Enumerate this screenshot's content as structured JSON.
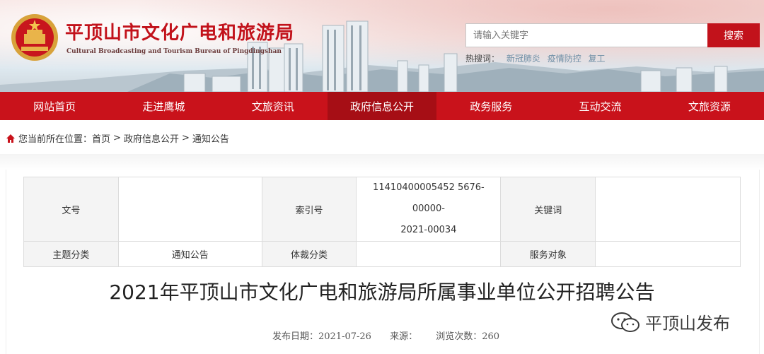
{
  "header": {
    "title": "平顶山市文化广电和旅游局",
    "subtitle": "Cultural Broadcasting and Tourism Bureau of Pingdingshan",
    "search_placeholder": "请输入关键字",
    "search_button": "搜索",
    "hot_label": "热搜词：",
    "hot_words": [
      "新冠肺炎",
      "疫情防控",
      "复工"
    ]
  },
  "nav": {
    "items": [
      "网站首页",
      "走进鹰城",
      "文旅资讯",
      "政府信息公开",
      "政务服务",
      "互动交流",
      "文旅资源"
    ],
    "active": "政府信息公开"
  },
  "breadcrumb": {
    "prefix": "您当前所在位置：",
    "items": [
      "首页",
      "政府信息公开",
      "通知公告"
    ],
    "separator": ">"
  },
  "info": {
    "doc_no_label": "文号",
    "doc_no_value": "",
    "index_label": "索引号",
    "index_value_line1": "11410400005452 5676-00000-",
    "index_value_line2": "2021-00034",
    "keyword_label": "关键词",
    "keyword_value": "",
    "topic_label": "主题分类",
    "topic_value": "通知公告",
    "genre_label": "体裁分类",
    "genre_value": "",
    "audience_label": "服务对象",
    "audience_value": ""
  },
  "article": {
    "title": "2021年平顶山市文化广电和旅游局所属事业单位公开招聘公告",
    "publish_date": "发布日期：2021-07-26",
    "source": "来源：",
    "views": "浏览次数：260"
  },
  "watermark": {
    "text": "平顶山发布"
  },
  "colors": {
    "brand_red": "#c9121b",
    "active_red": "#a60e15"
  }
}
